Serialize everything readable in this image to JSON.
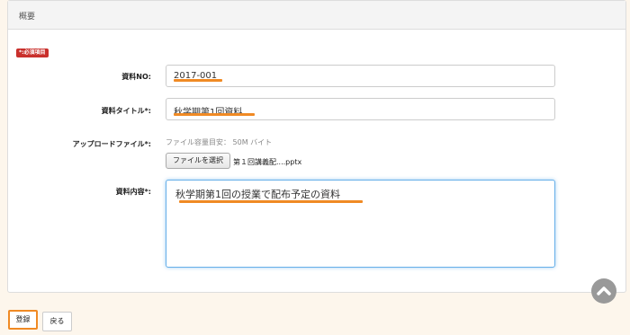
{
  "panel": {
    "title": "概要"
  },
  "required_badge": "*:必須項目",
  "form": {
    "doc_no_label": "資料NO:",
    "doc_no_value": "2017-001",
    "title_label": "資料タイトル*:",
    "title_value": "秋学期第1回資料",
    "upload_label": "アップロードファイル*:",
    "upload_hint": "ファイル容量目安： 50M バイト",
    "file_button": "ファイルを選択",
    "file_name": "第１回講義配....pptx",
    "content_label": "資料内容*:",
    "content_value": "秋学期第1回の授業で配布予定の資料"
  },
  "actions": {
    "save_label": "登録",
    "back_label": "戻る"
  },
  "colors": {
    "accent": "#f08a24",
    "badge": "#c9302c",
    "focus": "#66afe9"
  }
}
